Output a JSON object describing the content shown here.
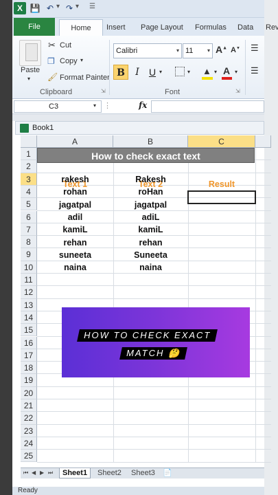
{
  "app": {
    "qat_icons": [
      "excel-logo-icon",
      "save-icon",
      "undo-icon",
      "redo-icon",
      "customize-qat-icon"
    ]
  },
  "tabs": {
    "file": "File",
    "home": "Home",
    "insert": "Insert",
    "page_layout": "Page Layout",
    "formulas": "Formulas",
    "data": "Data",
    "review": "Rev"
  },
  "ribbon": {
    "clipboard": {
      "paste": "Paste",
      "cut": "Cut",
      "copy": "Copy",
      "format_painter": "Format Painter",
      "group_label": "Clipboard"
    },
    "font": {
      "font_name": "Calibri",
      "font_size": "11",
      "bold": "B",
      "italic": "I",
      "underline": "U",
      "group_label": "Font"
    }
  },
  "formula_bar": {
    "name_box": "C3",
    "fx": "fx",
    "value": ""
  },
  "workbook": {
    "title": "Book1",
    "columns": [
      "A",
      "B",
      "C"
    ],
    "selected_column": "C",
    "rows": [
      "1",
      "2",
      "3",
      "4",
      "5",
      "6",
      "7",
      "8",
      "9",
      "10",
      "11",
      "12",
      "13",
      "14",
      "15",
      "16",
      "17",
      "18",
      "19",
      "20",
      "21",
      "22",
      "23",
      "24",
      "25"
    ],
    "selected_row": "3",
    "title_cell": "How to check exact text",
    "headers": [
      "Text 1",
      "Text 2",
      "Result"
    ],
    "data": [
      [
        "rakesh",
        "Rakesh"
      ],
      [
        "rohan",
        "roHan"
      ],
      [
        "jagatpal",
        "jagatpal"
      ],
      [
        "adil",
        "adiL"
      ],
      [
        "kamiL",
        "kamiL"
      ],
      [
        "rehan",
        "rehan"
      ],
      [
        "suneeta",
        "Suneeta"
      ],
      [
        "naina",
        "naina"
      ]
    ]
  },
  "banner": {
    "line1": "HOW TO CHECK EXACT",
    "line2": "MATCH 🤔",
    "colors": [
      "#5b2fd6",
      "#a73ae0"
    ]
  },
  "sheets": [
    "Sheet1",
    "Sheet2",
    "Sheet3"
  ],
  "active_sheet": "Sheet1",
  "status": "Ready"
}
